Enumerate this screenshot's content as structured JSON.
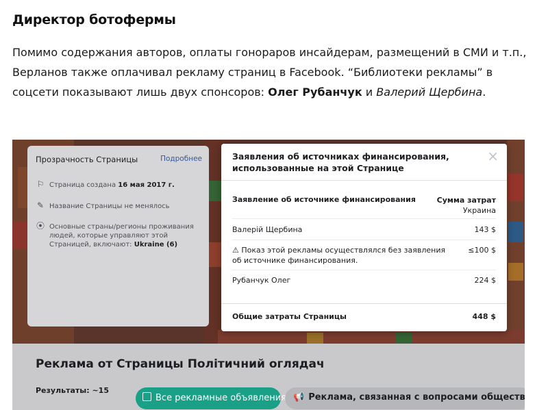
{
  "article": {
    "heading": "Директор ботофермы",
    "para_before_bold": "Помимо содержания авторов, оплаты гонораров инсайдерам, размещений в СМИ и т.п., Верланов также оплачивал рекламу страниц в Facebook. “Библиотеки рекламы” в соцсети показывают лишь двух спонсоров: ",
    "sponsor_bold": "Олег Рубанчук",
    "para_and": " и ",
    "sponsor_italic": "Валерий Щербина",
    "para_end": "."
  },
  "transparency_panel": {
    "title": "Прозрачность Страницы",
    "more_link": "Подробнее",
    "created_label": "Страница создана",
    "created_date": "16 мая 2017 г.",
    "name_unchanged": "Название Страницы не менялось",
    "countries_label": "Основные страны/регионы проживания людей, которые управляют этой Страницей, включают:",
    "countries_value": "Ukraine (6)"
  },
  "funding_modal": {
    "title": "Заявления об источниках финансирования, использованные на этой Странице",
    "close_symbol": "×",
    "col_statement": "Заявление об источнике финансирования",
    "col_amount": "Сумма затрат",
    "col_country": "Украина",
    "rows": [
      {
        "name": "Валерій Щербина",
        "amount": "143 $"
      },
      {
        "name": "⚠ Показ этой рекламы осуществлялся без заявления об источнике финансирования.",
        "amount": "≤100 $"
      },
      {
        "name": "Рубанчук Олег",
        "amount": "224 $"
      }
    ],
    "total_label": "Общие затраты Страницы",
    "total_value": "448 $"
  },
  "ads_section": {
    "title": "Реклама от Страницы Політичний оглядач",
    "results": "Результаты: ~15",
    "filter_all": "Все рекламные объявления",
    "filter_social": "Реклама, связанная с вопросами общественной зна"
  },
  "colors": {
    "accent_green": "#19a086",
    "link_blue": "#365899"
  }
}
